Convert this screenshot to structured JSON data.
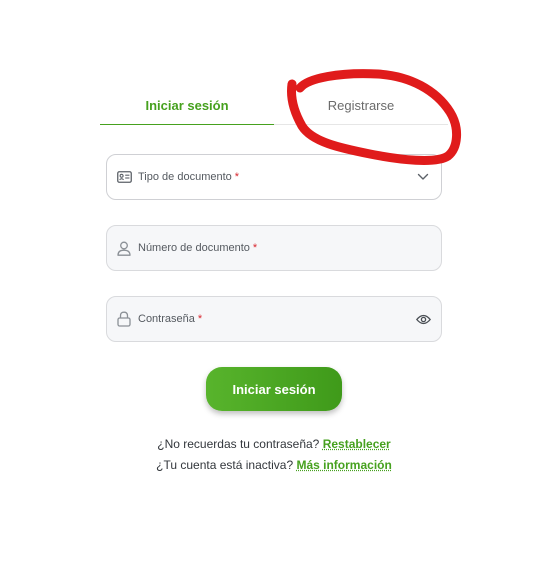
{
  "tabs": {
    "login": "Iniciar sesión",
    "register": "Registrarse"
  },
  "form": {
    "doc_type": {
      "label": "Tipo de documento",
      "required_mark": "*"
    },
    "doc_number": {
      "label": "Número de documento",
      "required_mark": "*"
    },
    "password": {
      "label": "Contraseña",
      "required_mark": "*"
    },
    "submit_label": "Iniciar sesión"
  },
  "help": {
    "forgot_text": "¿No recuerdas tu contraseña?",
    "forgot_link": "Restablecer",
    "inactive_text": "¿Tu cuenta está inactiva?",
    "inactive_link": "Más información"
  },
  "icons": {
    "doc_type": "id-card-icon",
    "doc_type_trailing": "chevron-down-icon",
    "doc_number": "user-icon",
    "password": "lock-icon",
    "password_trailing": "eye-icon"
  },
  "colors": {
    "accent": "#46a11e",
    "required": "#d8262e",
    "annotation": "#e01b1b"
  }
}
